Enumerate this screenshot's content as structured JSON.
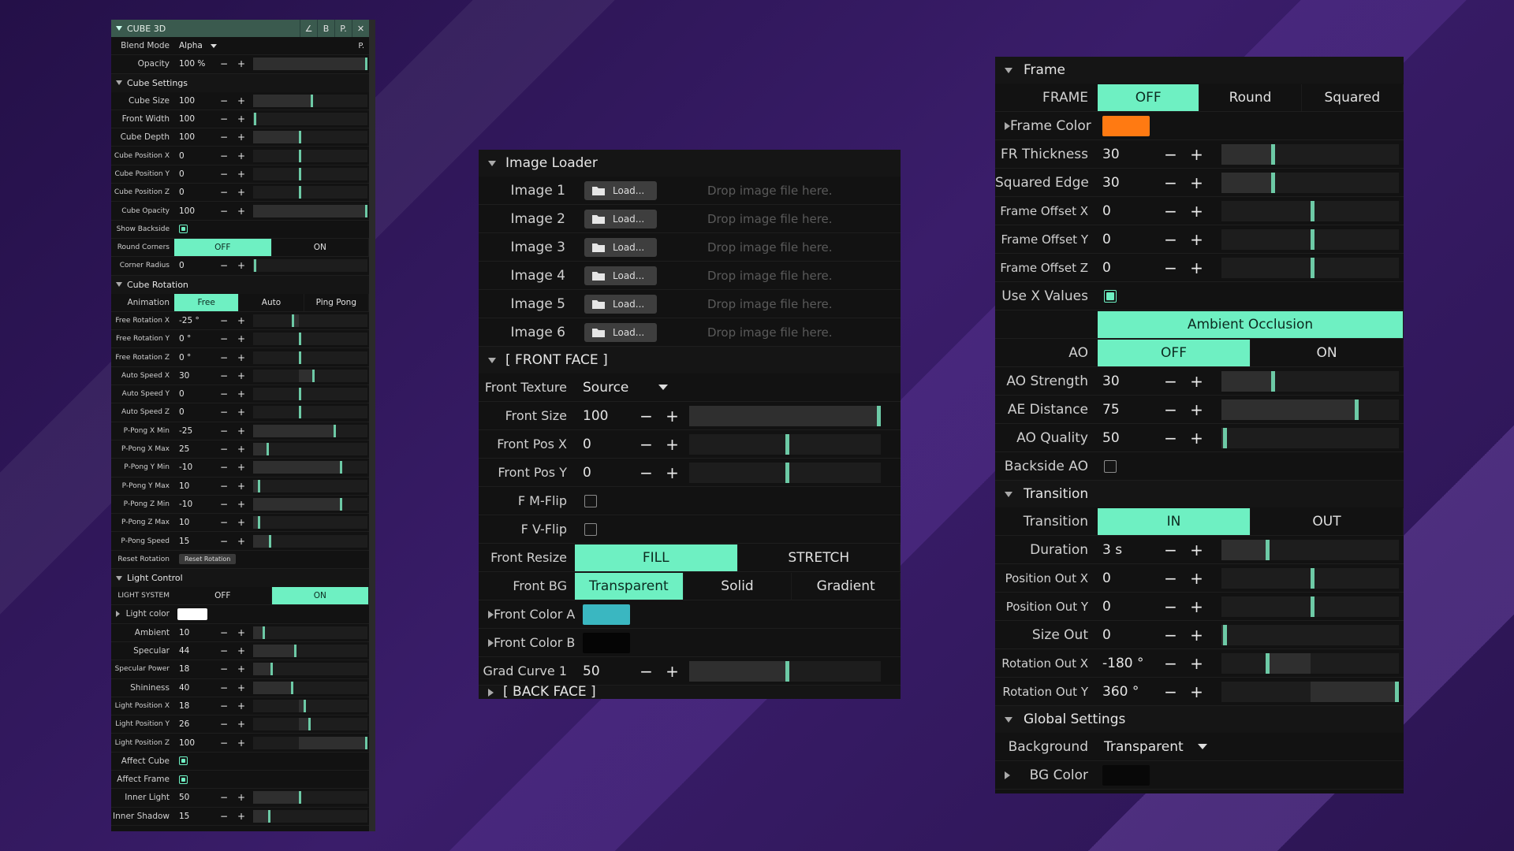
{
  "p1": {
    "title": "CUBE 3D",
    "title_buttons": [
      "∠",
      "B",
      "P.",
      "✕"
    ],
    "blend_label": "Blend Mode",
    "blend_value": "Alpha",
    "blend_p": "P.",
    "opacity": {
      "label": "Opacity",
      "value": "100 %",
      "pct": 100
    },
    "sec_cube": "Cube Settings",
    "cube": [
      {
        "label": "Cube Size",
        "value": "100",
        "pct": 50
      },
      {
        "label": "Front Width",
        "value": "100",
        "pct": 1
      },
      {
        "label": "Cube Depth",
        "value": "100",
        "pct": 40
      },
      {
        "label": "Cube Position X",
        "value": "0",
        "pct": 40,
        "sm": true
      },
      {
        "label": "Cube Position Y",
        "value": "0",
        "pct": 40,
        "sm": true
      },
      {
        "label": "Cube Position Z",
        "value": "0",
        "pct": 40,
        "sm": true
      },
      {
        "label": "Cube Opacity",
        "value": "100",
        "pct": 100,
        "sm": true
      }
    ],
    "show_backside": "Show Backside",
    "round_corners": {
      "label": "Round Corners",
      "options": [
        "OFF",
        "ON"
      ],
      "active": 0
    },
    "corner_radius": {
      "label": "Corner Radius",
      "value": "0",
      "pct": 1
    },
    "sec_rotation": "Cube Rotation",
    "animation": {
      "label": "Animation",
      "options": [
        "Free",
        "Auto",
        "Ping Pong"
      ],
      "active": 0
    },
    "rotation": [
      {
        "label": "Free Rotation X",
        "value": "-25 °",
        "pct": 34
      },
      {
        "label": "Free Rotation Y",
        "value": "0 °",
        "pct": 40
      },
      {
        "label": "Free Rotation Z",
        "value": "0 °",
        "pct": 40
      },
      {
        "label": "Auto Speed X",
        "value": "30",
        "pct": 52
      },
      {
        "label": "Auto Speed Y",
        "value": "0",
        "pct": 40
      },
      {
        "label": "Auto Speed Z",
        "value": "0",
        "pct": 40
      },
      {
        "label": "P-Pong X Min",
        "value": "-25",
        "pct": 70
      },
      {
        "label": "P-Pong X Max",
        "value": "25",
        "pct": 12
      },
      {
        "label": "P-Pong Y Min",
        "value": "-10",
        "pct": 76
      },
      {
        "label": "P-Pong Y Max",
        "value": "10",
        "pct": 4
      },
      {
        "label": "P-Pong Z Min",
        "value": "-10",
        "pct": 76
      },
      {
        "label": "P-Pong Z Max",
        "value": "10",
        "pct": 4
      },
      {
        "label": "P-Pong Speed",
        "value": "15",
        "pct": 14
      }
    ],
    "reset_label": "Reset Rotation",
    "reset_button": "Reset Rotation",
    "sec_light": "Light Control",
    "light_system": {
      "label": "LIGHT SYSTEM",
      "options": [
        "OFF",
        "ON"
      ],
      "active": 1
    },
    "light_color": "Light color",
    "light": [
      {
        "label": "Ambient",
        "value": "10",
        "pct": 8,
        "sm": false
      },
      {
        "label": "Specular",
        "value": "44",
        "pct": 36,
        "sm": false
      },
      {
        "label": "Specular Power",
        "value": "18",
        "pct": 15,
        "sm": true
      },
      {
        "label": "Shininess",
        "value": "40",
        "pct": 33,
        "sm": false
      },
      {
        "label": "Light Position X",
        "value": "18",
        "pct": 44,
        "sm": true
      },
      {
        "label": "Light Position Y",
        "value": "26",
        "pct": 48,
        "sm": true
      },
      {
        "label": "Light Position Z",
        "value": "100",
        "pct": 100,
        "sm": true
      }
    ],
    "affect_cube": "Affect Cube",
    "affect_frame": "Affect Frame",
    "inner": [
      {
        "label": "Inner Light",
        "value": "50",
        "pct": 40,
        "sm": false
      },
      {
        "label": "Inner Shadow",
        "value": "15",
        "pct": 13,
        "sm": false
      }
    ],
    "minus": "−",
    "plus": "+"
  },
  "p2": {
    "sec_loader": "Image Loader",
    "images": [
      {
        "label": "Image 1",
        "button": "Load...",
        "hint": "Drop image file here."
      },
      {
        "label": "Image 2",
        "button": "Load...",
        "hint": "Drop image file here."
      },
      {
        "label": "Image 3",
        "button": "Load...",
        "hint": "Drop image file here."
      },
      {
        "label": "Image 4",
        "button": "Load...",
        "hint": "Drop image file here."
      },
      {
        "label": "Image 5",
        "button": "Load...",
        "hint": "Drop image file here."
      },
      {
        "label": "Image 6",
        "button": "Load...",
        "hint": "Drop image file here."
      }
    ],
    "sec_front": "[ FRONT FACE ]",
    "front_texture": {
      "label": "Front Texture",
      "value": "Source"
    },
    "front_sliders": [
      {
        "label": "Front Size",
        "value": "100",
        "pct": 100
      },
      {
        "label": "Front Pos X",
        "value": "0",
        "pct": 50
      },
      {
        "label": "Front Pos Y",
        "value": "0",
        "pct": 50
      }
    ],
    "mflip": "F M-Flip",
    "vflip": "F V-Flip",
    "front_resize": {
      "label": "Front Resize",
      "options": [
        "FILL",
        "STRETCH"
      ],
      "active": 0
    },
    "front_bg": {
      "label": "Front BG",
      "options": [
        "Transparent",
        "Solid",
        "Gradient"
      ],
      "active": 0
    },
    "color_a": {
      "label": "Front Color A",
      "color": "#3ab7c1"
    },
    "color_b": {
      "label": "Front Color B",
      "color": "#050505"
    },
    "grad_curve": {
      "label": "Grad Curve 1",
      "value": "50",
      "pct": 50
    },
    "sec_back": "[ BACK FACE ]",
    "minus": "−",
    "plus": "+"
  },
  "p3": {
    "sec_frame": "Frame",
    "frame_mode": {
      "label": "FRAME",
      "options": [
        "OFF",
        "Round",
        "Squared"
      ],
      "active": 0
    },
    "frame_color": {
      "label": "Frame Color",
      "color": "#ff7a12"
    },
    "frame_sliders": [
      {
        "label": "FR Thickness",
        "value": "30",
        "pct": 28,
        "sm": false
      },
      {
        "label": "Squared Edge",
        "value": "30",
        "pct": 28,
        "sm": false
      },
      {
        "label": "Frame Offset X",
        "value": "0",
        "pct": 50,
        "sm": true
      },
      {
        "label": "Frame Offset Y",
        "value": "0",
        "pct": 50,
        "sm": true
      },
      {
        "label": "Frame Offset Z",
        "value": "0",
        "pct": 50,
        "sm": true
      }
    ],
    "use_x": "Use X Values",
    "ao_header": "Ambient Occlusion",
    "ao_toggle": {
      "label": "AO",
      "options": [
        "OFF",
        "ON"
      ],
      "active": 0
    },
    "ao_sliders": [
      {
        "label": "AO Strength",
        "value": "30",
        "pct": 28
      },
      {
        "label": "AE Distance",
        "value": "75",
        "pct": 75
      },
      {
        "label": "AO Quality",
        "value": "50",
        "pct": 1
      }
    ],
    "backside_ao": "Backside AO",
    "sec_transition": "Transition",
    "transition_toggle": {
      "label": "Transition",
      "options": [
        "IN",
        "OUT"
      ],
      "active": 0
    },
    "transition_sliders": [
      {
        "label": "Duration",
        "value": "3 s",
        "pct": 25,
        "sm": false
      },
      {
        "label": "Position Out X",
        "value": "0",
        "pct": 50,
        "sm": true
      },
      {
        "label": "Position Out Y",
        "value": "0",
        "pct": 50,
        "sm": true
      },
      {
        "label": "Size Out",
        "value": "0",
        "pct": 1,
        "sm": false
      },
      {
        "label": "Rotation Out X",
        "value": "-180 °",
        "pct": 25,
        "sm": true
      },
      {
        "label": "Rotation Out Y",
        "value": "360 °",
        "pct": 100,
        "sm": true
      }
    ],
    "sec_global": "Global Settings",
    "background": {
      "label": "Background",
      "value": "Transparent"
    },
    "bg_color": {
      "label": "BG Color",
      "color": "#080808"
    },
    "minus": "−",
    "plus": "+"
  },
  "colors": {
    "accent": "#6ef0c2",
    "knob": "#6dcaa6",
    "panel": "#121212"
  }
}
